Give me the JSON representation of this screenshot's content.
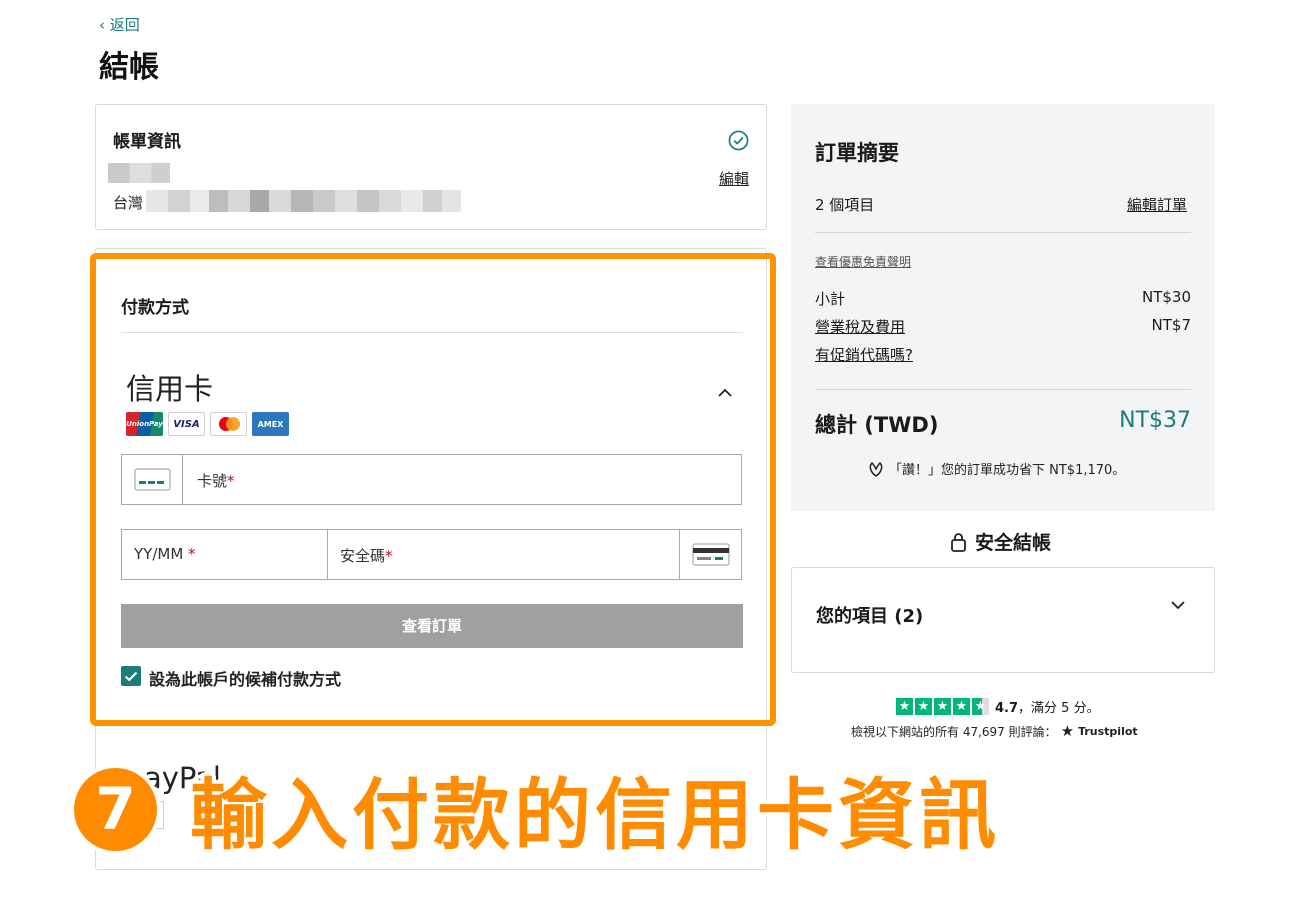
{
  "nav": {
    "back_label": "‹ 返回"
  },
  "page": {
    "title": "結帳"
  },
  "billing": {
    "title": "帳單資訊",
    "country": "台灣",
    "edit_label": "編輯"
  },
  "payment": {
    "title": "付款方式",
    "credit_card_title": "信用卡",
    "card_logos": [
      "UnionPay",
      "VISA",
      "Mastercard",
      "AMEX"
    ],
    "card_number_placeholder": "卡號",
    "expiry_placeholder": "YY/MM ",
    "cvv_placeholder": "安全碼",
    "required_mark": "*",
    "review_button": "查看訂單",
    "save_backup_label": "設為此帳戶的候補付款方式",
    "paypal_partial": "ayPal"
  },
  "annotation": {
    "step_number": "7",
    "text": "輸入付款的信用卡資訊"
  },
  "summary": {
    "title": "訂單摘要",
    "items_count": "2 個項目",
    "edit_order": "編輯訂單",
    "disclaimer": "查看優惠免責聲明",
    "subtotal_label": "小計",
    "subtotal_value": "NT$30",
    "tax_label": "營業稅及費用",
    "tax_value": "NT$7",
    "promo_label": "有促銷代碼嗎?",
    "total_label": "總計 (TWD)",
    "total_value": "NT$37",
    "savings_text": "「讚！」您的訂單成功省下 NT$1,170。"
  },
  "secure_checkout": "安全結帳",
  "your_items": {
    "title": "您的項目 (2)"
  },
  "trustpilot": {
    "rating": "4.7",
    "rating_suffix": "，滿分 5 分。",
    "reviews_text": "檢視以下網站的所有 47,697 則評論：",
    "brand": "Trustpilot",
    "stars_value": 4.7
  },
  "colors": {
    "accent": "#1d7c7a",
    "highlight": "#ff9400",
    "trust_green": "#00b67a"
  }
}
